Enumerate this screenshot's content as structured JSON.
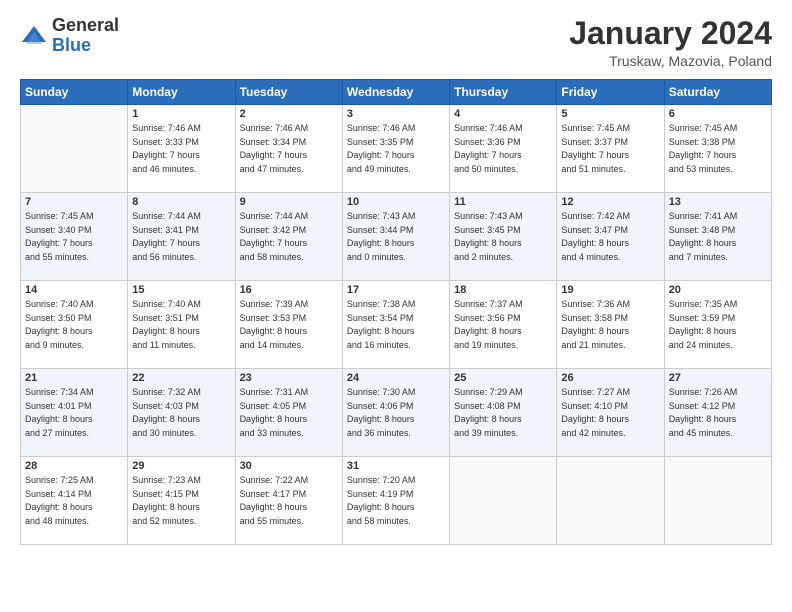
{
  "header": {
    "logo": {
      "general": "General",
      "blue": "Blue"
    },
    "title": "January 2024",
    "subtitle": "Truskaw, Mazovia, Poland"
  },
  "calendar": {
    "days_of_week": [
      "Sunday",
      "Monday",
      "Tuesday",
      "Wednesday",
      "Thursday",
      "Friday",
      "Saturday"
    ],
    "weeks": [
      [
        {
          "num": "",
          "info": ""
        },
        {
          "num": "1",
          "info": "Sunrise: 7:46 AM\nSunset: 3:33 PM\nDaylight: 7 hours\nand 46 minutes."
        },
        {
          "num": "2",
          "info": "Sunrise: 7:46 AM\nSunset: 3:34 PM\nDaylight: 7 hours\nand 47 minutes."
        },
        {
          "num": "3",
          "info": "Sunrise: 7:46 AM\nSunset: 3:35 PM\nDaylight: 7 hours\nand 49 minutes."
        },
        {
          "num": "4",
          "info": "Sunrise: 7:46 AM\nSunset: 3:36 PM\nDaylight: 7 hours\nand 50 minutes."
        },
        {
          "num": "5",
          "info": "Sunrise: 7:45 AM\nSunset: 3:37 PM\nDaylight: 7 hours\nand 51 minutes."
        },
        {
          "num": "6",
          "info": "Sunrise: 7:45 AM\nSunset: 3:38 PM\nDaylight: 7 hours\nand 53 minutes."
        }
      ],
      [
        {
          "num": "7",
          "info": "Sunrise: 7:45 AM\nSunset: 3:40 PM\nDaylight: 7 hours\nand 55 minutes."
        },
        {
          "num": "8",
          "info": "Sunrise: 7:44 AM\nSunset: 3:41 PM\nDaylight: 7 hours\nand 56 minutes."
        },
        {
          "num": "9",
          "info": "Sunrise: 7:44 AM\nSunset: 3:42 PM\nDaylight: 7 hours\nand 58 minutes."
        },
        {
          "num": "10",
          "info": "Sunrise: 7:43 AM\nSunset: 3:44 PM\nDaylight: 8 hours\nand 0 minutes."
        },
        {
          "num": "11",
          "info": "Sunrise: 7:43 AM\nSunset: 3:45 PM\nDaylight: 8 hours\nand 2 minutes."
        },
        {
          "num": "12",
          "info": "Sunrise: 7:42 AM\nSunset: 3:47 PM\nDaylight: 8 hours\nand 4 minutes."
        },
        {
          "num": "13",
          "info": "Sunrise: 7:41 AM\nSunset: 3:48 PM\nDaylight: 8 hours\nand 7 minutes."
        }
      ],
      [
        {
          "num": "14",
          "info": "Sunrise: 7:40 AM\nSunset: 3:50 PM\nDaylight: 8 hours\nand 9 minutes."
        },
        {
          "num": "15",
          "info": "Sunrise: 7:40 AM\nSunset: 3:51 PM\nDaylight: 8 hours\nand 11 minutes."
        },
        {
          "num": "16",
          "info": "Sunrise: 7:39 AM\nSunset: 3:53 PM\nDaylight: 8 hours\nand 14 minutes."
        },
        {
          "num": "17",
          "info": "Sunrise: 7:38 AM\nSunset: 3:54 PM\nDaylight: 8 hours\nand 16 minutes."
        },
        {
          "num": "18",
          "info": "Sunrise: 7:37 AM\nSunset: 3:56 PM\nDaylight: 8 hours\nand 19 minutes."
        },
        {
          "num": "19",
          "info": "Sunrise: 7:36 AM\nSunset: 3:58 PM\nDaylight: 8 hours\nand 21 minutes."
        },
        {
          "num": "20",
          "info": "Sunrise: 7:35 AM\nSunset: 3:59 PM\nDaylight: 8 hours\nand 24 minutes."
        }
      ],
      [
        {
          "num": "21",
          "info": "Sunrise: 7:34 AM\nSunset: 4:01 PM\nDaylight: 8 hours\nand 27 minutes."
        },
        {
          "num": "22",
          "info": "Sunrise: 7:32 AM\nSunset: 4:03 PM\nDaylight: 8 hours\nand 30 minutes."
        },
        {
          "num": "23",
          "info": "Sunrise: 7:31 AM\nSunset: 4:05 PM\nDaylight: 8 hours\nand 33 minutes."
        },
        {
          "num": "24",
          "info": "Sunrise: 7:30 AM\nSunset: 4:06 PM\nDaylight: 8 hours\nand 36 minutes."
        },
        {
          "num": "25",
          "info": "Sunrise: 7:29 AM\nSunset: 4:08 PM\nDaylight: 8 hours\nand 39 minutes."
        },
        {
          "num": "26",
          "info": "Sunrise: 7:27 AM\nSunset: 4:10 PM\nDaylight: 8 hours\nand 42 minutes."
        },
        {
          "num": "27",
          "info": "Sunrise: 7:26 AM\nSunset: 4:12 PM\nDaylight: 8 hours\nand 45 minutes."
        }
      ],
      [
        {
          "num": "28",
          "info": "Sunrise: 7:25 AM\nSunset: 4:14 PM\nDaylight: 8 hours\nand 48 minutes."
        },
        {
          "num": "29",
          "info": "Sunrise: 7:23 AM\nSunset: 4:15 PM\nDaylight: 8 hours\nand 52 minutes."
        },
        {
          "num": "30",
          "info": "Sunrise: 7:22 AM\nSunset: 4:17 PM\nDaylight: 8 hours\nand 55 minutes."
        },
        {
          "num": "31",
          "info": "Sunrise: 7:20 AM\nSunset: 4:19 PM\nDaylight: 8 hours\nand 58 minutes."
        },
        {
          "num": "",
          "info": ""
        },
        {
          "num": "",
          "info": ""
        },
        {
          "num": "",
          "info": ""
        }
      ]
    ]
  }
}
